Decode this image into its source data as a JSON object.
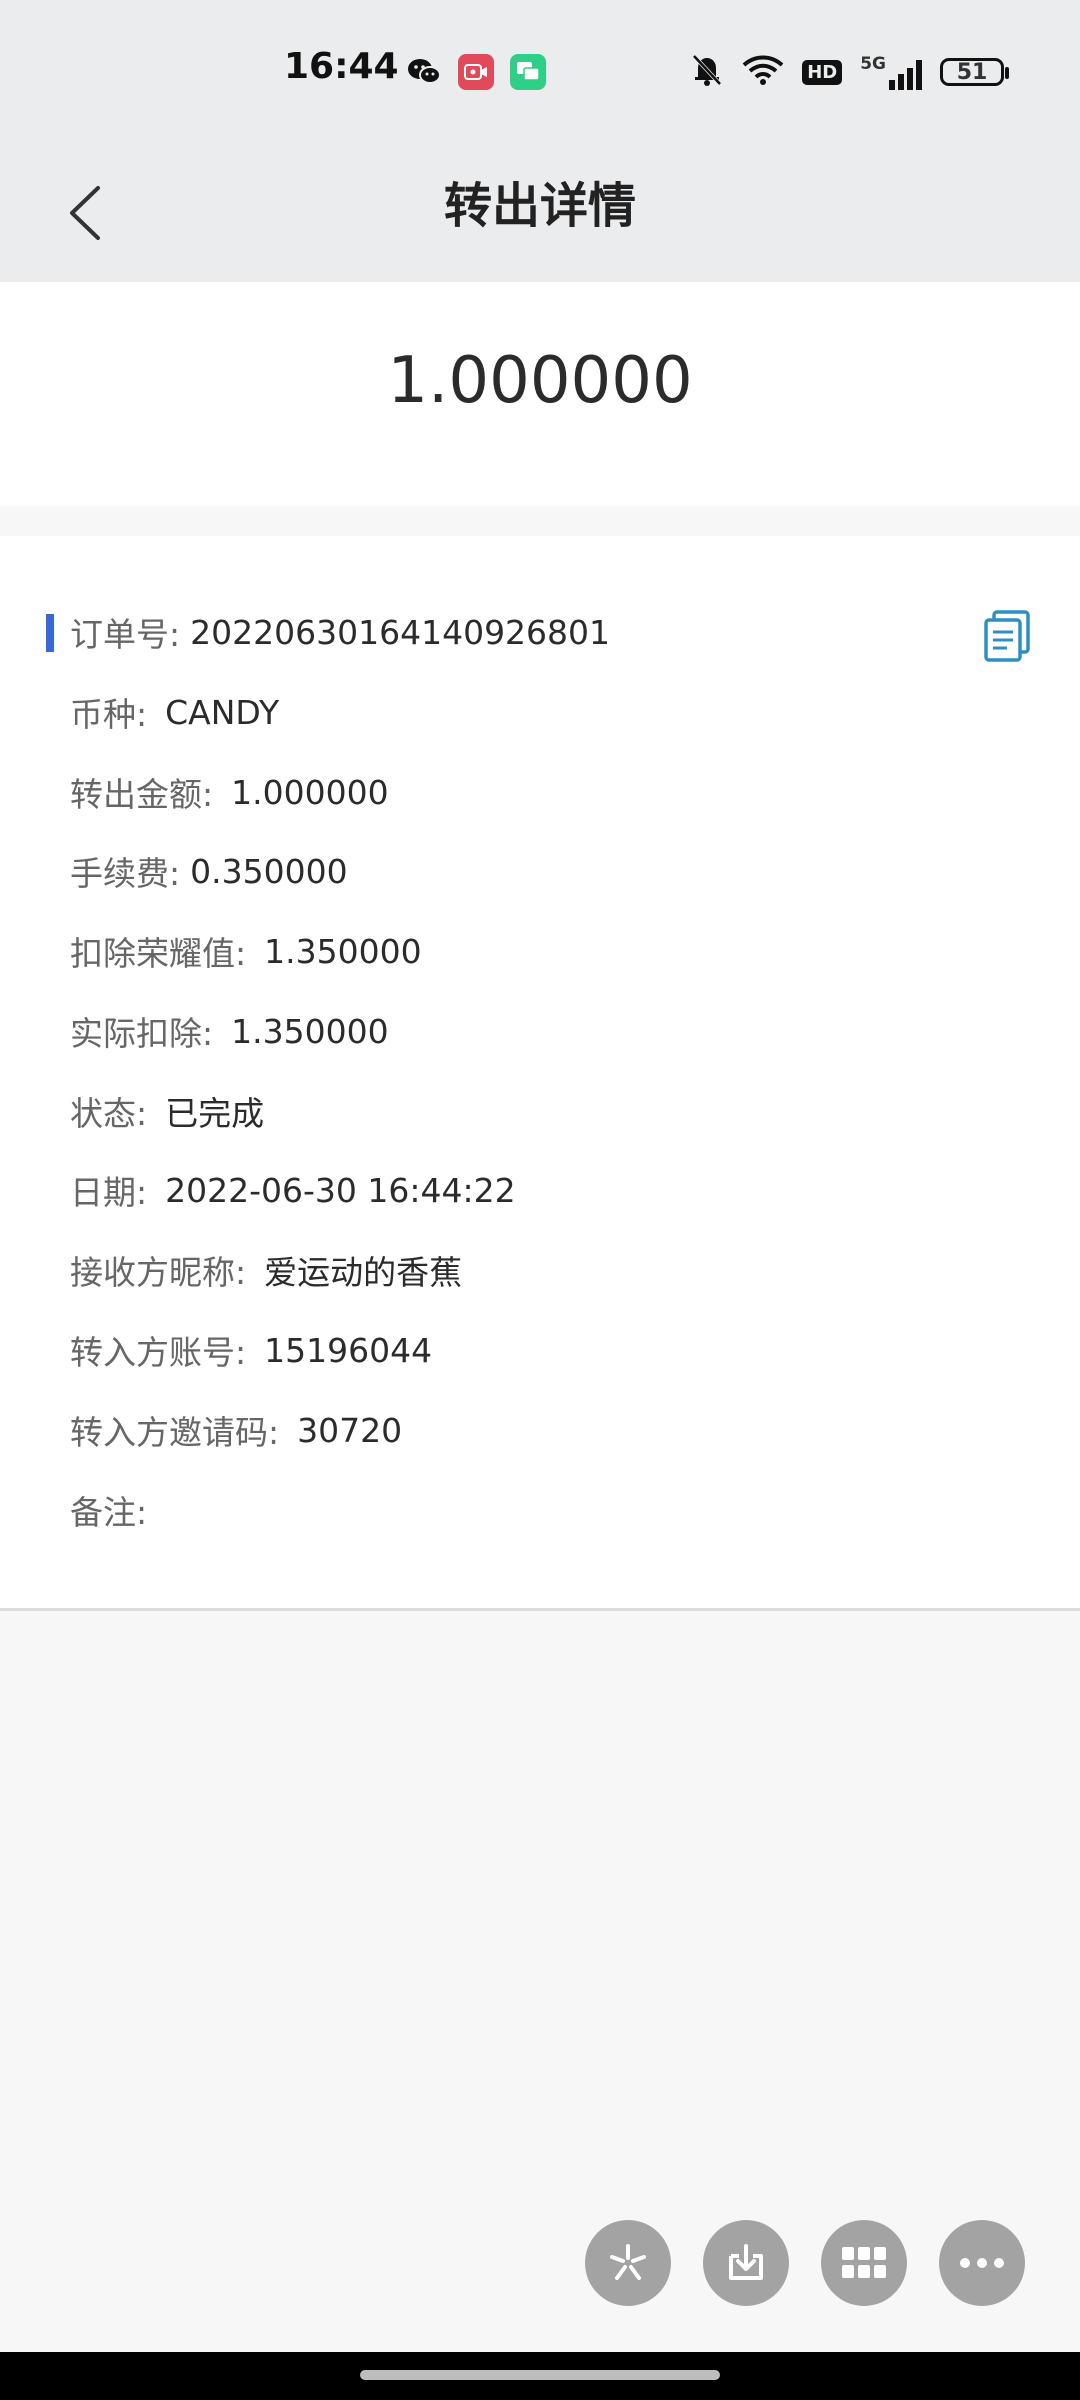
{
  "status_bar": {
    "time": "16:44",
    "battery": "51",
    "network": "5G",
    "hd_badge": "HD",
    "icons": [
      "wechat-icon",
      "screen-record-icon",
      "message-icon",
      "mute-icon",
      "wifi-icon",
      "hd-icon",
      "signal-icon",
      "battery-icon"
    ]
  },
  "nav": {
    "title": "转出详情",
    "back_icon": "chevron-left-icon"
  },
  "amount": "1.000000",
  "details": {
    "order_no": {
      "label": "订单号:",
      "value": "20220630164140926801"
    },
    "currency": {
      "label": "币种:",
      "value": "CANDY"
    },
    "transfer_amount": {
      "label": "转出金额:",
      "value": "1.000000"
    },
    "fee": {
      "label": "手续费:",
      "value": "0.350000"
    },
    "honor_deducted": {
      "label": "扣除荣耀值:",
      "value": "1.350000"
    },
    "actual_deducted": {
      "label": "实际扣除:",
      "value": "1.350000"
    },
    "status": {
      "label": "状态:",
      "value": "已完成"
    },
    "date": {
      "label": "日期:",
      "value": "2022-06-30 16:44:22"
    },
    "receiver_nickname": {
      "label": "接收方昵称:",
      "value": "爱运动的香蕉"
    },
    "receiver_account": {
      "label": "转入方账号:",
      "value": "15196044"
    },
    "receiver_invite": {
      "label": "转入方邀请码:",
      "value": "30720"
    },
    "remark": {
      "label": "备注:",
      "value": ""
    }
  },
  "copy_icon": "copy-document-icon",
  "fabs": [
    "sparkle-icon",
    "download-icon",
    "grid-icon",
    "more-icon"
  ],
  "colors": {
    "accent": "#3a66d8",
    "copy_icon": "#2f8fc0",
    "header_bg": "#ebecee",
    "fab_bg": "#a3a3a3"
  }
}
